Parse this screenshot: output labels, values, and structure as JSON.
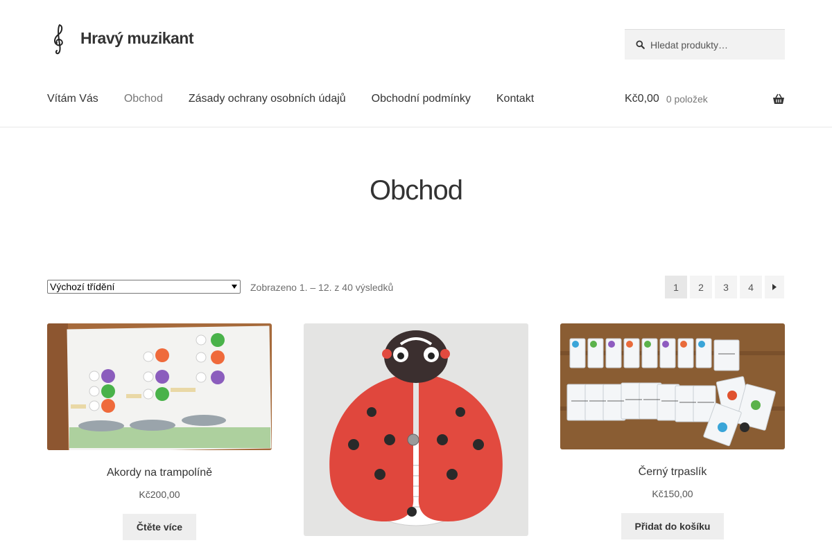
{
  "site": {
    "title": "Hravý muzikant",
    "logo_icon": "treble-clef-icon"
  },
  "search": {
    "placeholder": "Hledat produkty…",
    "icon": "search-icon"
  },
  "nav": {
    "items": [
      {
        "label": "Vítám Vás"
      },
      {
        "label": "Obchod",
        "active": true
      },
      {
        "label": "Zásady ochrany osobních údajů"
      },
      {
        "label": "Obchodní podmínky"
      },
      {
        "label": "Kontakt"
      }
    ]
  },
  "cart": {
    "amount": "Kč0,00",
    "count": "0 položek",
    "icon": "basket-icon"
  },
  "page": {
    "title": "Obchod"
  },
  "toolbar": {
    "sort_selected": "Výchozí třídění",
    "result_count": "Zobrazeno 1. – 12. z 40 výsledků",
    "pages": [
      "1",
      "2",
      "3",
      "4"
    ],
    "current_page": "1",
    "next_icon": "caret-right-icon"
  },
  "products": [
    {
      "name": "Akordy na trampolíně",
      "price": "Kč200,00",
      "button": "Čtěte více"
    },
    {
      "name": "",
      "price": "",
      "button": ""
    },
    {
      "name": "Černý trpaslík",
      "price": "Kč150,00",
      "button": "Přidat do košíku"
    }
  ],
  "colors": {
    "text": "#333333",
    "muted": "#777777",
    "button_bg": "#eeeeee",
    "search_bg": "#f2f2f2"
  }
}
